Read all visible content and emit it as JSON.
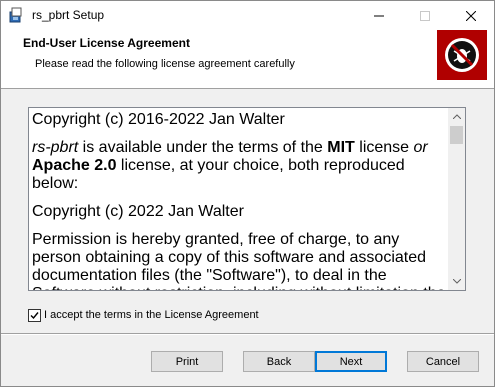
{
  "window": {
    "title": "rs_pbrt Setup"
  },
  "titlebar": {
    "minimize_icon": "minimize-icon",
    "maximize_icon": "maximize-icon",
    "close_icon": "close-icon"
  },
  "header": {
    "title": "End-User License Agreement",
    "subtitle": "Please read the following license agreement carefully",
    "logo": "no-bug-logo",
    "logo_color": "#b00000"
  },
  "license": {
    "p1": "Copyright (c) 2016-2022 Jan Walter",
    "p2a": "rs-pbrt",
    "p2b": " is available under the terms of the ",
    "p2c": "MIT",
    "p2d": " license ",
    "p2e": "or",
    "p2f": "Apache 2.0",
    "p2g": " license, at your choice, both reproduced below:",
    "p3": "Copyright (c) 2022 Jan Walter",
    "p4": "Permission is hereby granted, free of charge, to any person obtaining a copy of this software and associated documentation files (the \"Software\"), to deal in the Software without restriction, including without limitation the rights to"
  },
  "accept": {
    "label": "I accept the terms in the License Agreement",
    "checked": true
  },
  "buttons": {
    "print": "Print",
    "back": "Back",
    "next": "Next",
    "cancel": "Cancel"
  }
}
